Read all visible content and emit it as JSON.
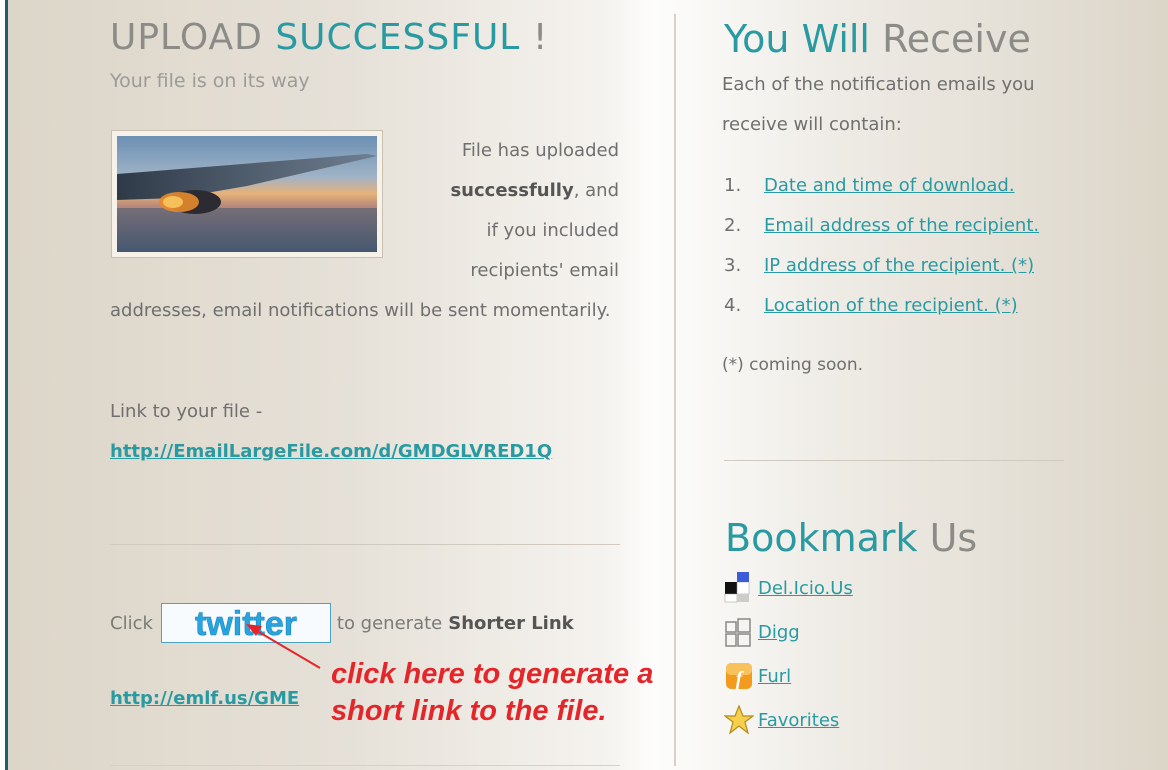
{
  "upload": {
    "title_part1": "UPLOAD ",
    "title_part2": "SUCCESSFUL",
    "title_part3": " !",
    "subtitle": "Your file is on its way",
    "float_lines": [
      "File has uploaded",
      "successfully",
      ", and",
      "if you included",
      "recipients' email"
    ],
    "body_text": "addresses, email notifications will be sent momentarily.",
    "link_label": "Link to your file -",
    "file_link": "http://EmailLargeFile.com/d/GMDGLVRED1Q",
    "click_prefix": "Click",
    "twitter_label": "twitter",
    "click_suffix": "to generate",
    "click_bold": "Shorter Link",
    "short_link": "http://emlf.us/GME",
    "annotation_line1": "click here to generate a",
    "annotation_line2": "short link to the file."
  },
  "receive": {
    "title_part1": "You Will ",
    "title_part2": "Receive",
    "description": "Each of the notification emails you receive will contain:",
    "items": [
      {
        "num": "1.",
        "text": "Date and time of download."
      },
      {
        "num": "2.",
        "text": "Email address of the recipient."
      },
      {
        "num": "3.",
        "text": "IP address of the recipient. (*)"
      },
      {
        "num": "4.",
        "text": "Location of the recipient. (*)"
      }
    ],
    "note": "(*) coming soon."
  },
  "bookmark": {
    "title_part1": "Bookmark ",
    "title_part2": "Us",
    "items": [
      {
        "label": "Del.Icio.Us",
        "icon": "delicious-icon"
      },
      {
        "label": "Digg",
        "icon": "digg-icon"
      },
      {
        "label": "Furl",
        "icon": "furl-icon"
      },
      {
        "label": "Favorites",
        "icon": "favorites-star-icon"
      }
    ]
  },
  "colors": {
    "accent": "#2a9aa2",
    "annotation": "#e4262a",
    "twitter_blue": "#2aa4e0",
    "left_bar": "#1f5c6e"
  }
}
